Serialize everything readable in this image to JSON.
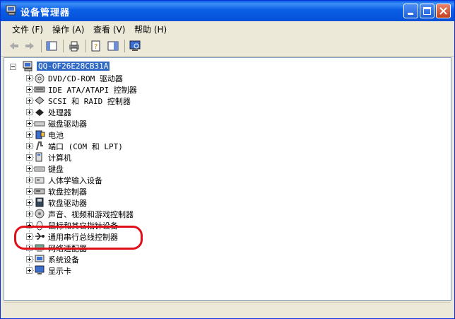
{
  "window": {
    "title": "设备管理器"
  },
  "menu": [
    "文件 (F)",
    "操作 (A)",
    "查看 (V)",
    "帮助 (H)"
  ],
  "tree": {
    "root": "QQ-OF26E28CB31A",
    "items": [
      {
        "label": "DVD/CD-ROM 驱动器",
        "icon": "dvd-icon"
      },
      {
        "label": "IDE ATA/ATAPI 控制器",
        "icon": "ide-icon"
      },
      {
        "label": "SCSI 和 RAID 控制器",
        "icon": "scsi-icon"
      },
      {
        "label": "处理器",
        "icon": "cpu-icon"
      },
      {
        "label": "磁盘驱动器",
        "icon": "disk-icon"
      },
      {
        "label": "电池",
        "icon": "battery-icon"
      },
      {
        "label": "端口 (COM 和 LPT)",
        "icon": "port-icon"
      },
      {
        "label": "计算机",
        "icon": "computer-icon"
      },
      {
        "label": "键盘",
        "icon": "keyboard-icon"
      },
      {
        "label": "人体学输入设备",
        "icon": "hid-icon"
      },
      {
        "label": "软盘控制器",
        "icon": "floppy-controller-icon"
      },
      {
        "label": "软盘驱动器",
        "icon": "floppy-drive-icon"
      },
      {
        "label": "声音、视频和游戏控制器",
        "icon": "sound-icon"
      },
      {
        "label": "鼠标和其它指针设备",
        "icon": "mouse-icon"
      },
      {
        "label": "通用串行总线控制器",
        "icon": "usb-icon"
      },
      {
        "label": "网络适配器",
        "icon": "network-icon"
      },
      {
        "label": "系统设备",
        "icon": "system-icon"
      },
      {
        "label": "显示卡",
        "icon": "display-icon"
      }
    ]
  },
  "colors": {
    "titlebar": "#0a5ee6",
    "selection": "#316ac5",
    "annotation": "#e0101a"
  }
}
